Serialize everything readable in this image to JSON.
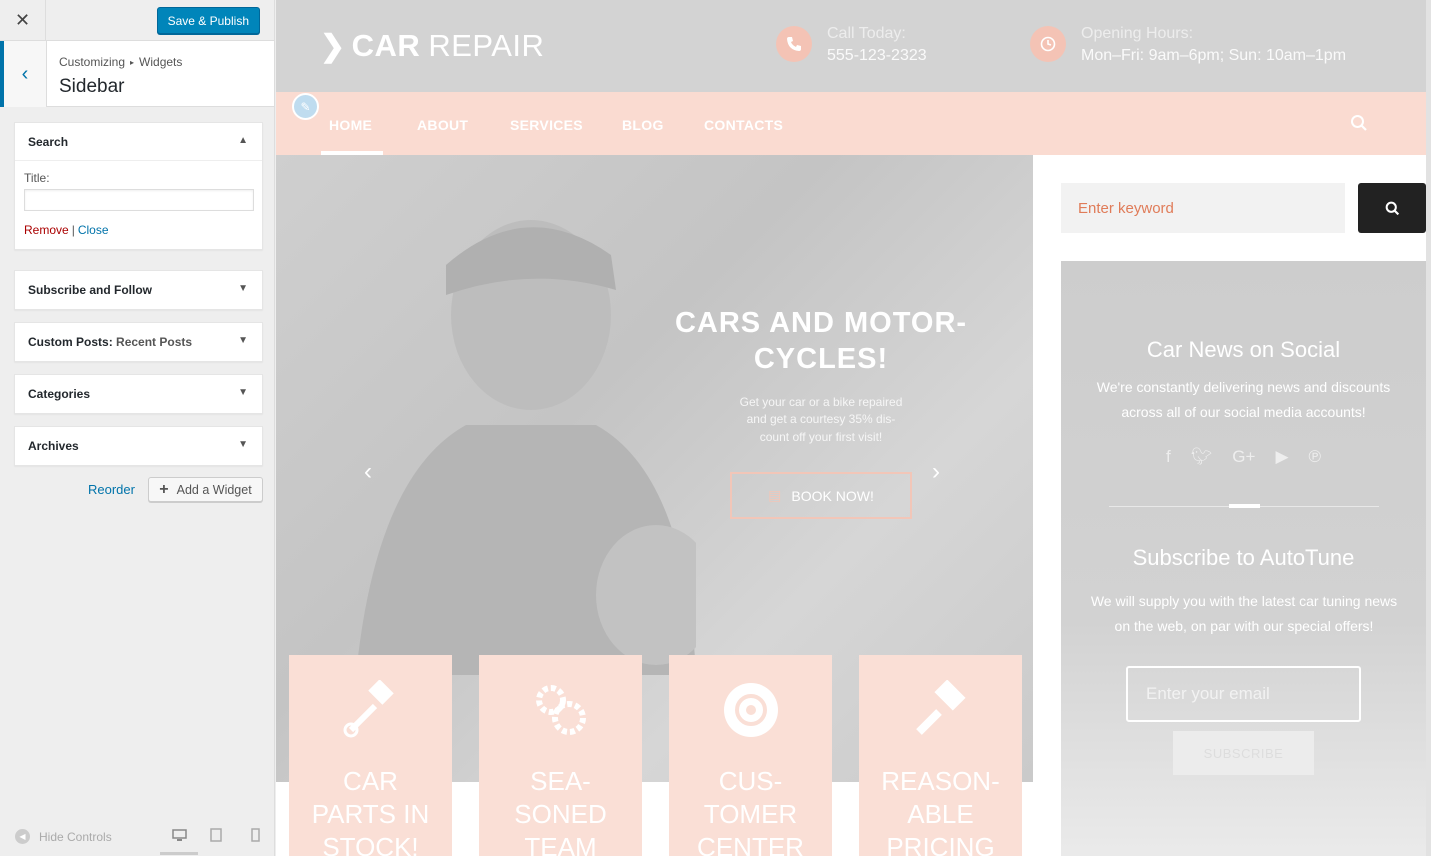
{
  "customizer": {
    "close_icon": "close-icon",
    "save_label": "Save & Publish",
    "breadcrumb": {
      "root": "Customizing",
      "child": "Widgets"
    },
    "section_title": "Sidebar",
    "widgets": [
      {
        "title": "Search",
        "expanded": true
      },
      {
        "title": "Subscribe and Follow",
        "expanded": false
      },
      {
        "title": "Custom Posts",
        "subtitle": "Recent Posts",
        "expanded": false
      },
      {
        "title": "Categories",
        "expanded": false
      },
      {
        "title": "Archives",
        "expanded": false
      }
    ],
    "search_widget": {
      "title_label": "Title:",
      "title_value": "",
      "remove_label": "Remove",
      "separator": "|",
      "close_label": "Close"
    },
    "reorder_label": "Reorder",
    "add_widget_label": "Add a Widget",
    "hide_controls_label": "Hide Controls",
    "devices": [
      "desktop",
      "tablet",
      "mobile"
    ],
    "accent_color": "#0085ba"
  },
  "site": {
    "logo": {
      "bold": "CAR",
      "light": "REPAIR"
    },
    "contact_call": {
      "label": "Call Today:",
      "value": "555-123-2323"
    },
    "contact_hours": {
      "label": "Opening Hours:",
      "value": "Mon–Fri: 9am–6pm; Sun: 10am–1pm"
    },
    "nav": [
      "HOME",
      "ABOUT",
      "SERVICES",
      "BLOG",
      "CONTACTS"
    ],
    "active_nav": "HOME",
    "hero": {
      "title_line1": "CARS AND MOTOR-",
      "title_line2": "CYCLES!",
      "text_line1": "Get your car or a bike repaired",
      "text_line2": "and get a courtesy 35% dis-",
      "text_line3": "count off your first visit!",
      "button": "BOOK NOW!"
    },
    "features": [
      {
        "line1": "CAR",
        "line2": "PARTS IN",
        "line3": "STOCK!",
        "icon": "piston-icon"
      },
      {
        "line1": "SEA-",
        "line2": "SONED",
        "line3": "TEAM",
        "icon": "gears-icon"
      },
      {
        "line1": "CUS-",
        "line2": "TOMER",
        "line3": "CENTER",
        "icon": "brake-disc-icon"
      },
      {
        "line1": "REASON-",
        "line2": "ABLE",
        "line3": "PRICING",
        "icon": "paint-brush-icon"
      }
    ],
    "sidebar": {
      "search_placeholder": "Enter keyword",
      "news_title": "Car News on Social",
      "news_text_line1": "We're constantly delivering news and discounts",
      "news_text_line2": "across all of our social media accounts!",
      "social": [
        "facebook-icon",
        "twitter-icon",
        "google-plus-icon",
        "youtube-icon",
        "pinterest-icon"
      ],
      "subscribe_title": "Subscribe to AutoTune",
      "subscribe_text_line1": "We will supply you with the latest car tuning news",
      "subscribe_text_line2": "on the web, on par with our special offers!",
      "email_placeholder": "Enter your email",
      "subscribe_button": "SUBSCRIBE"
    },
    "colors": {
      "topbar": "#d3d3d3",
      "navbar": "#fadbd1",
      "accent": "#e07c59"
    }
  }
}
